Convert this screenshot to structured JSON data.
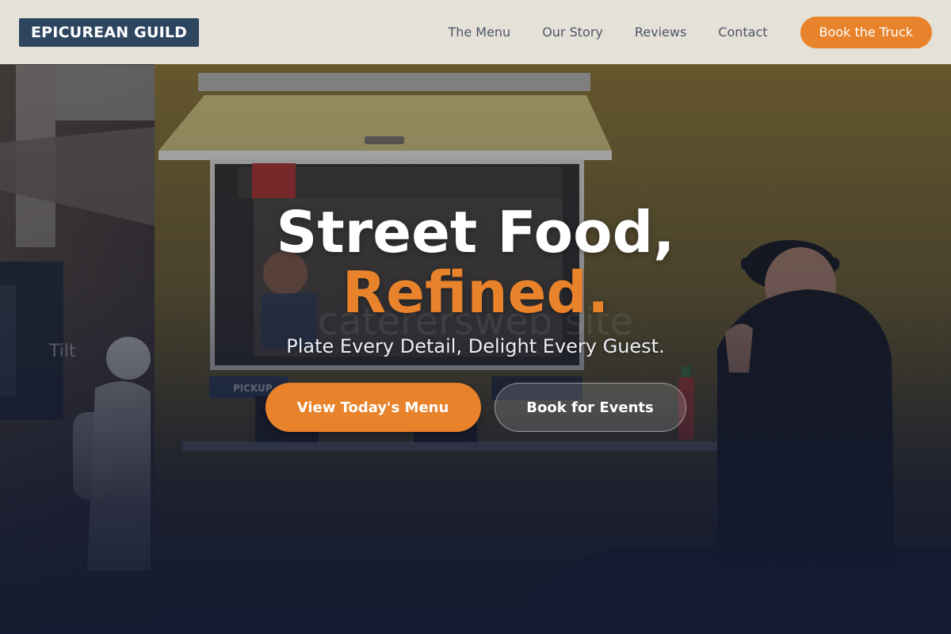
{
  "brand": {
    "logo_text": "EPICUREAN GUILD"
  },
  "nav": {
    "links": [
      {
        "label": "The Menu"
      },
      {
        "label": "Our Story"
      },
      {
        "label": "Reviews"
      },
      {
        "label": "Contact"
      }
    ],
    "cta_label": "Book the Truck"
  },
  "hero": {
    "title_line1": "Street Food,",
    "title_line2": "Refined.",
    "watermark": "caterersweb site",
    "subtitle": "Plate Every Detail, Delight Every Guest.",
    "primary_button": "View Today's Menu",
    "secondary_button": "Book for Events",
    "truck_sign": "PICKUP",
    "truck_side": "Tilt"
  },
  "colors": {
    "accent": "#e8832b",
    "logo_bg": "#2e4560",
    "nav_bg": "#ece9e2",
    "nav_text": "#4b5567",
    "hero_dark": "#1a2033",
    "truck_yellow": "#8a7230"
  }
}
